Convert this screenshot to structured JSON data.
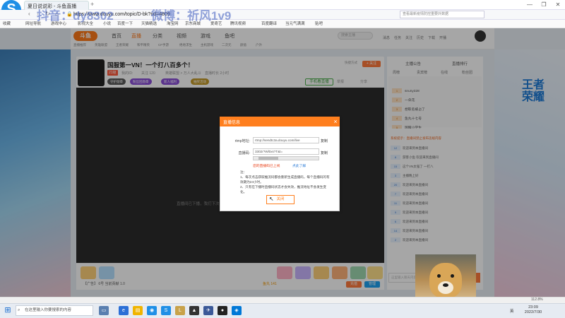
{
  "browser": {
    "tab_title": "夏日说说彩 - 斗鱼直播",
    "new_tab": "+",
    "url": "https://www.douyu.com/topic/D-bk?rid=4809",
    "search_placeholder": "查看最新疫情防控重要外数据",
    "min_btn": "—",
    "max_btn": "❐",
    "close_btn": "✕",
    "bookmarks": [
      "收藏",
      "网址导航",
      "游戏中心",
      "影视大全",
      "小说",
      "百度一下",
      "天猫精选",
      "淘宝网",
      "京东商城",
      "爱奇艺",
      "腾讯视频",
      "百度翻译",
      "当元气满满",
      "贴吧"
    ],
    "status_zoom": "112.8%"
  },
  "watermark": {
    "line1": "抖音：dy8302",
    "line2": "微博：祈风1v9"
  },
  "site": {
    "logo": "斗鱼",
    "nav": [
      "首页",
      "直播",
      "分类",
      "视频",
      "游戏",
      "鱼吧"
    ],
    "search_placeholder": "搜索主播",
    "header_icons": [
      "消息",
      "任务",
      "关注",
      "历史",
      "下载",
      "开播"
    ],
    "subnav": [
      "直播推荐",
      "英雄联盟",
      "王者荣耀",
      "和平精英",
      "CF手游",
      "绝地求生",
      "主机游戏",
      "二次元",
      "颜值",
      "户外"
    ]
  },
  "room": {
    "title": "国服第一VN！一个打八百多个！",
    "badge": "21级",
    "meta": [
      "我的ID:",
      "关注 120",
      "英雄联盟 > 万人大乱斗",
      "直播时长 2小时"
    ],
    "pills": [
      "守护勋章",
      "粉丝团勋章",
      "新人福利",
      "抽奖活动"
    ],
    "shortcut": "快捷方式",
    "follow": "+ 关注",
    "mobile_watch": "手机看直播",
    "report": "举报",
    "share": "分享"
  },
  "video": {
    "label": "直播间已下播，我们下次见"
  },
  "giftbar": {
    "contrib": "【广告】 6号 当前贡献 1.0",
    "fishball": "鱼丸 141",
    "recharge": "充值",
    "manage": "管理"
  },
  "panel": {
    "tabs": [
      "主播公告",
      "直播排行"
    ],
    "subtabs": [
      "周榜",
      "贵宾榜",
      "在线",
      "粉丝团"
    ],
    "ranks": [
      {
        "badge": "1",
        "name": "snuny328"
      },
      {
        "badge": "2",
        "name": "一朵花"
      },
      {
        "badge": "3",
        "name": "想取名被占了"
      },
      {
        "badge": "4",
        "name": "鱼丸十七号"
      },
      {
        "badge": "5",
        "name": "国服小学生"
      }
    ],
    "chat": [
      {
        "badge": "",
        "text": "系统提示：直播间禁止发布违规内容",
        "sys": true
      },
      {
        "badge": "12",
        "text": "欢迎来到本直播间",
        "sys": false
      },
      {
        "badge": "8",
        "text": "游客小鱼 欢迎来到直播间",
        "sys": false
      },
      {
        "badge": "15",
        "text": "这个VN太强了 一打八",
        "sys": false
      },
      {
        "badge": "3",
        "text": "主播晚上好",
        "sys": false
      },
      {
        "badge": "20",
        "text": "欢迎来到本直播间",
        "sys": false
      },
      {
        "badge": "7",
        "text": "欢迎来到本直播间",
        "sys": false
      },
      {
        "badge": "11",
        "text": "欢迎来到本直播间",
        "sys": false
      },
      {
        "badge": "9",
        "text": "欢迎来到本直播间",
        "sys": false
      },
      {
        "badge": "6",
        "text": "欢迎来到本直播间",
        "sys": false
      },
      {
        "badge": "14",
        "text": "欢迎来到本直播间",
        "sys": false
      },
      {
        "badge": "2",
        "text": "欢迎来到本直播间",
        "sys": false
      }
    ],
    "chat_placeholder": "这里输入聊天内容",
    "send": "发送"
  },
  "modal": {
    "title": "直播信息",
    "rtmp_label": "rtmp地址:",
    "rtmp_value": "rtmp://sendtc3a.douyu.com/live",
    "key_label": "直播码:",
    "key_value": "3302r?Wl0xs?T&t=",
    "copy": "复制",
    "warn": "您的直播码已上线",
    "reset": "点此了解",
    "notes_title": "注：",
    "notes": [
      "1、每次点击获取推流码都会重新生成直播码，每个直播码的有效期为24小时。",
      "2、只有在下播时直播码状态才会失效，推流地址不会发生变化。"
    ],
    "close": "关闭",
    "close_icon": "×"
  },
  "taskbar": {
    "start_icon": "windows-icon",
    "search": "在这里输入你要搜索的内容",
    "lang": "英",
    "time": "23:09",
    "date": "2022/7/30"
  }
}
